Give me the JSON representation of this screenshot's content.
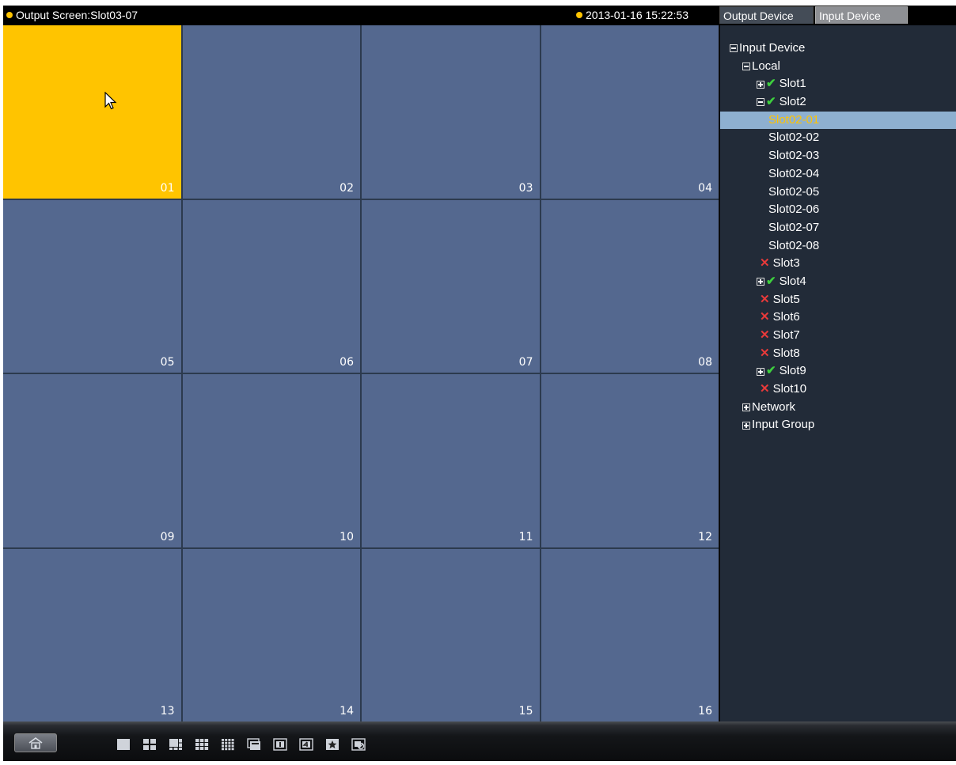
{
  "header": {
    "title": "Output Screen:Slot03-07",
    "datetime": "2013-01-16 15:22:53",
    "tabs": [
      "Output Device",
      "Input Device"
    ]
  },
  "grid": {
    "cells": [
      "01",
      "02",
      "03",
      "04",
      "05",
      "06",
      "07",
      "08",
      "09",
      "10",
      "11",
      "12",
      "13",
      "14",
      "15",
      "16"
    ],
    "active_cell": "01"
  },
  "tree": {
    "root": "Input Device",
    "local": "Local",
    "slots": [
      "Slot1",
      "Slot2",
      "Slot3",
      "Slot4",
      "Slot5",
      "Slot6",
      "Slot7",
      "Slot8",
      "Slot9",
      "Slot10"
    ],
    "slot2_children": [
      "Slot02-01",
      "Slot02-02",
      "Slot02-03",
      "Slot02-04",
      "Slot02-05",
      "Slot02-06",
      "Slot02-07",
      "Slot02-08"
    ],
    "network": "Network",
    "input_group": "Input Group"
  },
  "colors": {
    "active_cell": "#ffc400",
    "cell": "#54688f",
    "online": "#3ecf3e",
    "offline": "#e83a3a",
    "selection": "#8eb0d0"
  },
  "toolbar": {
    "icons": [
      "home-icon",
      "layout-1-icon",
      "layout-4-icon",
      "layout-6-icon",
      "layout-9-icon",
      "layout-16-icon",
      "layout-tour-icon",
      "screen-1-icon",
      "screen-4-icon",
      "favorite-icon",
      "clear-icon"
    ]
  }
}
